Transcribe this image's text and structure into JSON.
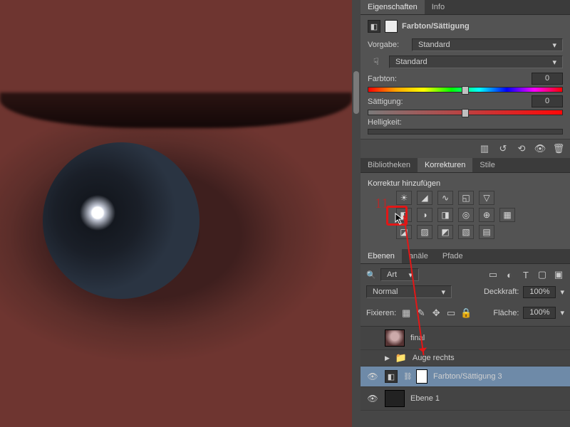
{
  "properties": {
    "tab_properties": "Eigenschaften",
    "tab_info": "Info",
    "adjustment_name": "Farbton/Sättigung",
    "preset_label": "Vorgabe:",
    "preset_value": "Standard",
    "channel_value": "Standard",
    "hue_label": "Farbton:",
    "hue_value": "0",
    "sat_label": "Sättigung:",
    "sat_value": "0",
    "light_label": "Helligkeit:"
  },
  "corrections": {
    "tab_lib": "Bibliotheken",
    "tab_corr": "Korrekturen",
    "tab_styles": "Stile",
    "add_label": "Korrektur hinzufügen"
  },
  "layers_panel": {
    "tab_layers": "Ebenen",
    "tab_channels": "anäle",
    "tab_paths": "Pfade",
    "filter_kind": "Art",
    "blend_mode": "Normal",
    "opacity_label": "Deckkraft:",
    "opacity_value": "100%",
    "lock_label": "Fixieren:",
    "fill_label": "Fläche:",
    "fill_value": "100%"
  },
  "layers": [
    {
      "name": "final"
    },
    {
      "name": "Auge rechts"
    },
    {
      "name": "Farbton/Sättigung 3"
    },
    {
      "name": "Ebene 1"
    }
  ],
  "annot": {
    "step": "11"
  }
}
